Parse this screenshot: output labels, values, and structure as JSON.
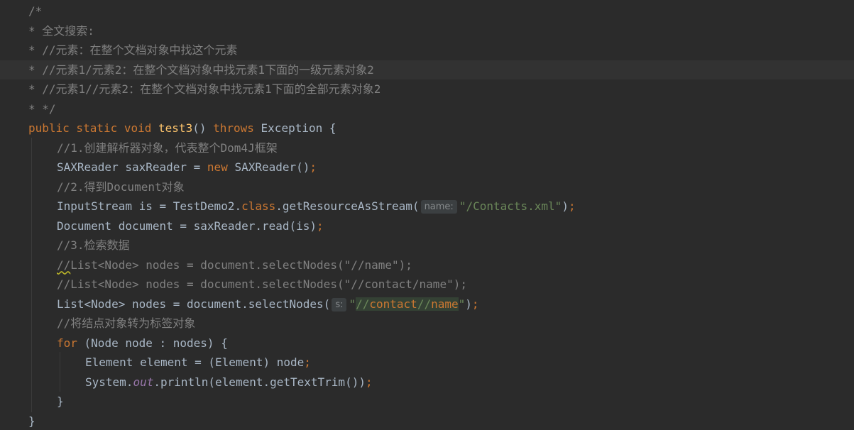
{
  "editor": {
    "lines": {
      "l1": "/*",
      "l2": "* 全文搜索:",
      "l3": "* //元素：在整个文档对象中找这个元素",
      "l4": "* //元素1/元素2：在整个文档对象中找元素1下面的一级元素对象2",
      "l5": "* //元素1//元素2：在整个文档对象中找元素1下面的全部元素对象2",
      "l6": "* */",
      "l7": {
        "kw_mods": "public static void ",
        "method": "test3",
        "paren": "() ",
        "kw_throws": "throws",
        "rest": " Exception {"
      },
      "l8": "//1.创建解析器对象，代表整个Dom4J框架",
      "l9": {
        "pre": "SAXReader saxReader = ",
        "kw_new": "new",
        "post": " SAXReader()",
        "semi": ";"
      },
      "l10": "//2.得到Document对象",
      "l11": {
        "pre": "InputStream is = TestDemo2.",
        "kw_class": "class",
        "call": ".getResourceAsStream(",
        "hint": "name:",
        "string": "\"/Contacts.xml\"",
        "close": ")",
        "semi": ";"
      },
      "l12": {
        "code": "Document document = saxReader.read(is)",
        "semi": ";"
      },
      "l13": "//3.检索数据",
      "l14": {
        "slashes": "//",
        "rest": "List<Node> nodes = document.selectNodes(\"//name\");"
      },
      "l15": "//List<Node> nodes = document.selectNodes(\"//contact/name\");",
      "l16": {
        "pre": "List<Node> nodes = document.selectNodes(",
        "hint": "s:",
        "q_open": "\"",
        "p1": "//",
        "p2": "contact",
        "p3": "//",
        "p4": "name",
        "q_close": "\"",
        "close": ")",
        "semi": ";"
      },
      "l17": "//将结点对象转为标签对象",
      "l18": {
        "kw_for": "for",
        "rest": " (Node node : nodes) {"
      },
      "l19": {
        "code": "Element element = (Element) node",
        "semi": ";"
      },
      "l20": {
        "pre": "System.",
        "field": "out",
        "post": ".println(element.getTextTrim())",
        "semi": ";"
      },
      "l21": "}",
      "l22": "}"
    }
  },
  "colors": {
    "background": "#2b2b2b",
    "current_line": "#323232",
    "default_text": "#a9b7c6",
    "comment": "#808080",
    "keyword": "#cc7832",
    "method_declaration": "#ffc66d",
    "string": "#6a8759",
    "static_field": "#9876aa",
    "hint_background": "#3b3f41",
    "xpath_highlight": "#344134"
  }
}
